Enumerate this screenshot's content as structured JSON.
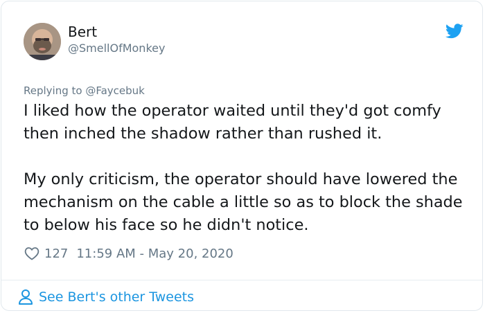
{
  "tweet": {
    "author_name": "Bert",
    "author_handle": "@SmellOfMonkey",
    "reply_prefix": "Replying to ",
    "reply_to": "@Faycebuk",
    "paragraphs": [
      "I liked how the operator waited until they'd got comfy then inched the shadow rather than rushed it.",
      "My only criticism, the operator should have lowered the mechanism on the cable a little so as to block the shade to below his face so he didn't notice."
    ],
    "like_count": "127",
    "timestamp": "11:59 AM - May 20, 2020"
  },
  "footer": {
    "see_more_label": "See Bert's other Tweets"
  },
  "icons": {
    "platform": "twitter-bird-icon",
    "like": "heart-icon",
    "profile": "person-icon"
  },
  "colors": {
    "accent": "#1da1f2",
    "link": "#1b95e0",
    "muted_text": "#657786",
    "primary_text": "#14171a",
    "border": "#e1e8ed"
  }
}
